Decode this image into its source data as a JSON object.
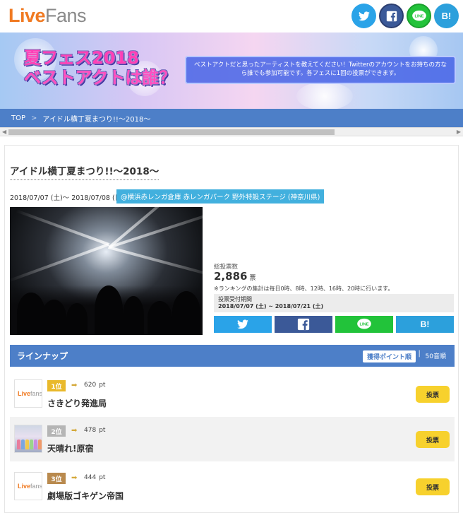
{
  "header": {
    "logo_live": "Live",
    "logo_fans": "Fans",
    "share": {
      "twitter": "🐦",
      "facebook": "f",
      "line": "LINE",
      "hatena": "B!"
    }
  },
  "banner": {
    "title_line1": "夏フェス2018",
    "title_line2": "ベストアクトは誰？",
    "description": "ベストアクトだと思ったアーティストを教えてください！Twitterのアカウントをお持ちの方なら誰でも参加可能です。各フェスに1回の投票ができます。"
  },
  "breadcrumb": {
    "home": "TOP",
    "separator": ">",
    "current": "アイドル横丁夏まつり!!～2018～"
  },
  "festival": {
    "title": "アイドル横丁夏まつり!!～2018～",
    "dates": "2018/07/07 (土)～ 2018/07/08 (日)",
    "venue": "@横浜赤レンガ倉庫 赤レンガパーク 野外特設ステージ (神奈川県)"
  },
  "votes": {
    "label": "総投票数",
    "count": "2,886",
    "unit": "票",
    "ranking_note": "※ランキングの集計は毎日0時、8時、12時、16時、20時に行います。",
    "period_label": "投票受付期間",
    "period_value": "2018/07/07 (土) ~ 2018/07/21 (土)"
  },
  "share_buttons": {
    "twitter": "🐦",
    "facebook": "f",
    "line": "LINE",
    "hatena": "B!"
  },
  "lineup": {
    "title": "ラインナップ",
    "sort_active": "獲得ポイント順",
    "sort_separator": "|",
    "sort_other": "50音順",
    "items": [
      {
        "rank": "1位",
        "points": "620",
        "unit": "pt",
        "name": "さきどり発進局",
        "vote": "投票",
        "thumb": "logo"
      },
      {
        "rank": "2位",
        "points": "478",
        "unit": "pt",
        "name": "天晴れ!原宿",
        "vote": "投票",
        "thumb": "photo"
      },
      {
        "rank": "3位",
        "points": "444",
        "unit": "pt",
        "name": "劇場版ゴキゲン帝国",
        "vote": "投票",
        "thumb": "logo"
      }
    ]
  },
  "colors": {
    "accent_blue": "#4d7fc8",
    "venue_blue": "#42b0de",
    "vote_yellow": "#f7d12d",
    "logo_orange": "#f07a22"
  }
}
